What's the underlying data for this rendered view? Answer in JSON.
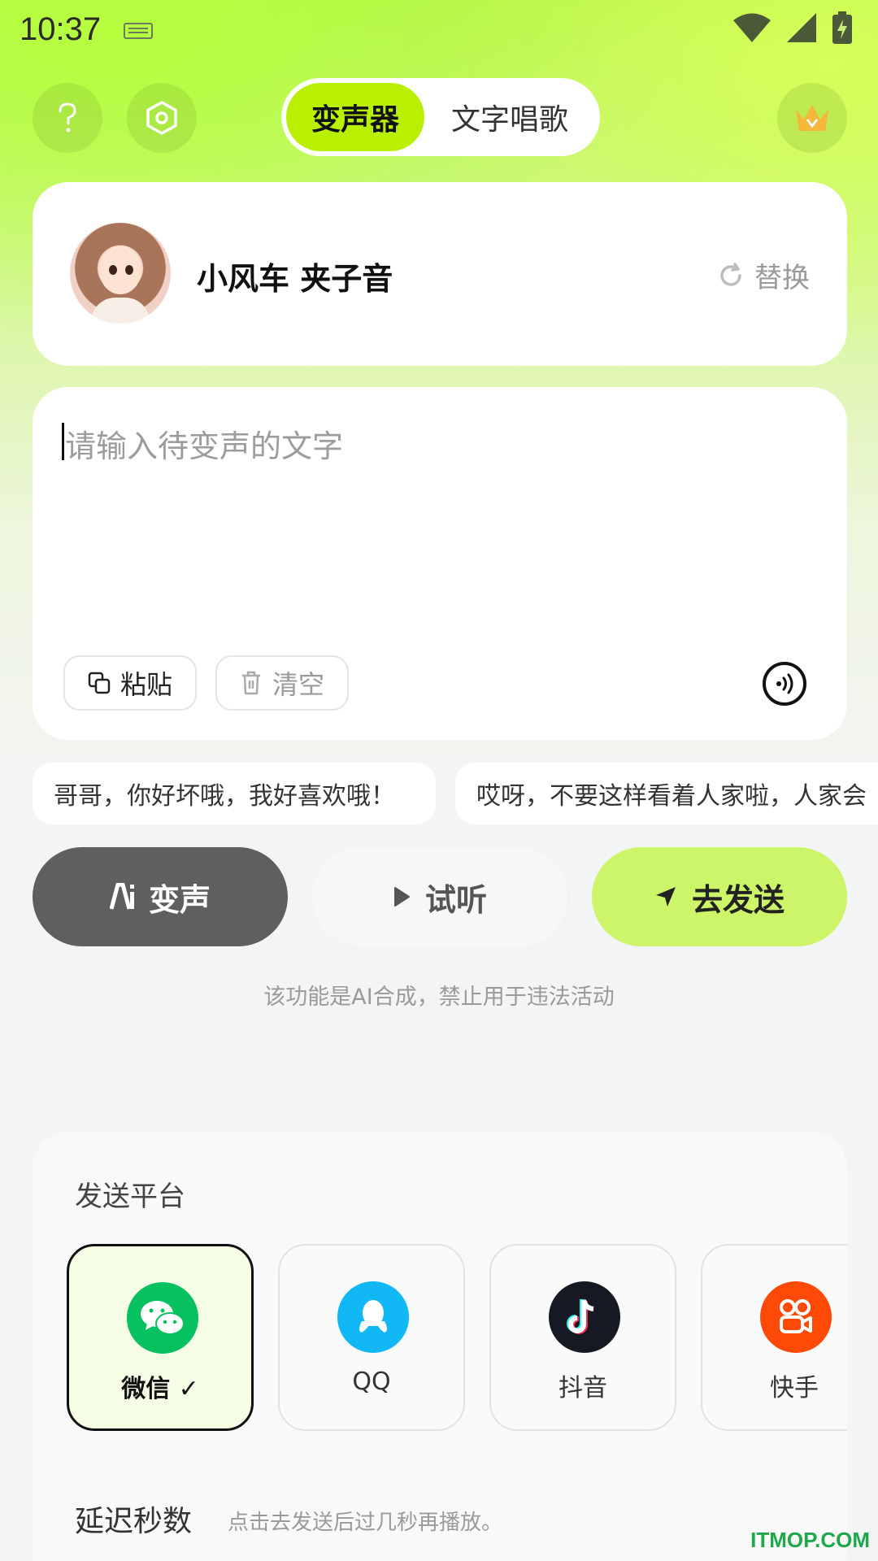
{
  "status_bar": {
    "time": "10:37"
  },
  "top_bar": {
    "tabs": [
      {
        "label": "变声器",
        "active": true
      },
      {
        "label": "文字唱歌",
        "active": false
      }
    ]
  },
  "voice": {
    "name": "小风车 夹子音",
    "replace_label": "替换"
  },
  "input": {
    "placeholder": "请输入待变声的文字",
    "paste_label": "粘贴",
    "clear_label": "清空"
  },
  "phrases": [
    "哥哥，你好坏哦，我好喜欢哦！",
    "哎呀，不要这样看着人家啦，人家会"
  ],
  "actions": {
    "ai_label": "变声",
    "listen_label": "试听",
    "send_label": "去发送"
  },
  "disclaimer": "该功能是AI合成，禁止用于违法活动",
  "platforms": {
    "title": "发送平台",
    "items": [
      {
        "label": "微信 ✓",
        "selected": true,
        "color": "#07c160"
      },
      {
        "label": "QQ",
        "selected": false,
        "color": "#12b7f5"
      },
      {
        "label": "抖音",
        "selected": false,
        "color": "#161823"
      },
      {
        "label": "快手",
        "selected": false,
        "color": "#ff4906"
      }
    ],
    "delay_title": "延迟秒数",
    "delay_hint": "点击去发送后过几秒再播放。"
  },
  "watermark": "ITMOP.COM",
  "colors": {
    "accent": "#b8f000",
    "send_button": "#cdf56a",
    "ai_button": "#5f5f5f"
  }
}
